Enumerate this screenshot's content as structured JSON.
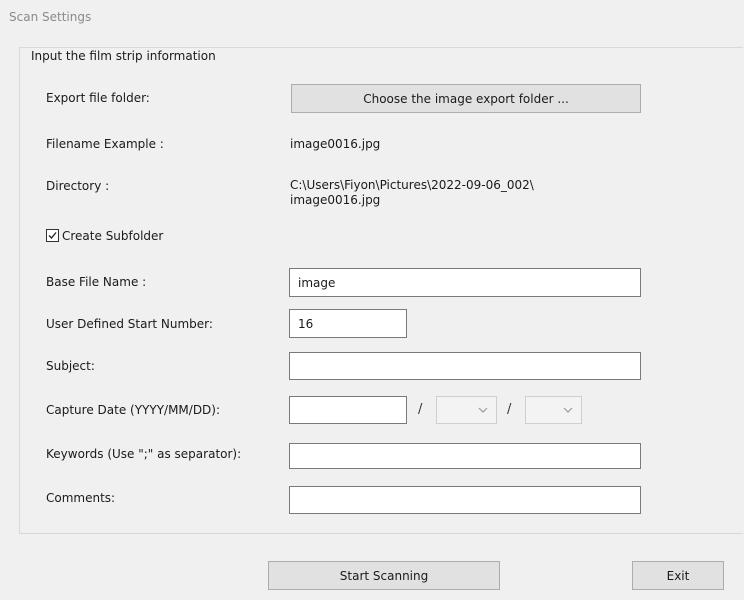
{
  "window": {
    "title": "Scan Settings"
  },
  "group": {
    "legend": "Input the film strip information"
  },
  "export": {
    "label": "Export file folder:",
    "button": "Choose the image export folder ..."
  },
  "filename_example": {
    "label": "Filename Example :",
    "value": "image0016.jpg"
  },
  "directory": {
    "label": "Directory :",
    "line1": "C:\\Users\\Fiyon\\Pictures\\2022-09-06_002\\",
    "line2": "image0016.jpg"
  },
  "subfolder": {
    "label": "Create Subfolder",
    "checked": true
  },
  "base_name": {
    "label": "Base File Name :",
    "value": "image"
  },
  "start_number": {
    "label": "User Defined Start Number:",
    "value": "16"
  },
  "subject": {
    "label": "Subject:",
    "value": ""
  },
  "capture_date": {
    "label": "Capture Date (YYYY/MM/DD):",
    "separator": "/",
    "year": "",
    "month": "",
    "day": ""
  },
  "keywords": {
    "label": "Keywords (Use \";\" as separator):",
    "value": ""
  },
  "comments": {
    "label": "Comments:",
    "value": ""
  },
  "footer": {
    "start": "Start Scanning",
    "exit": "Exit"
  }
}
